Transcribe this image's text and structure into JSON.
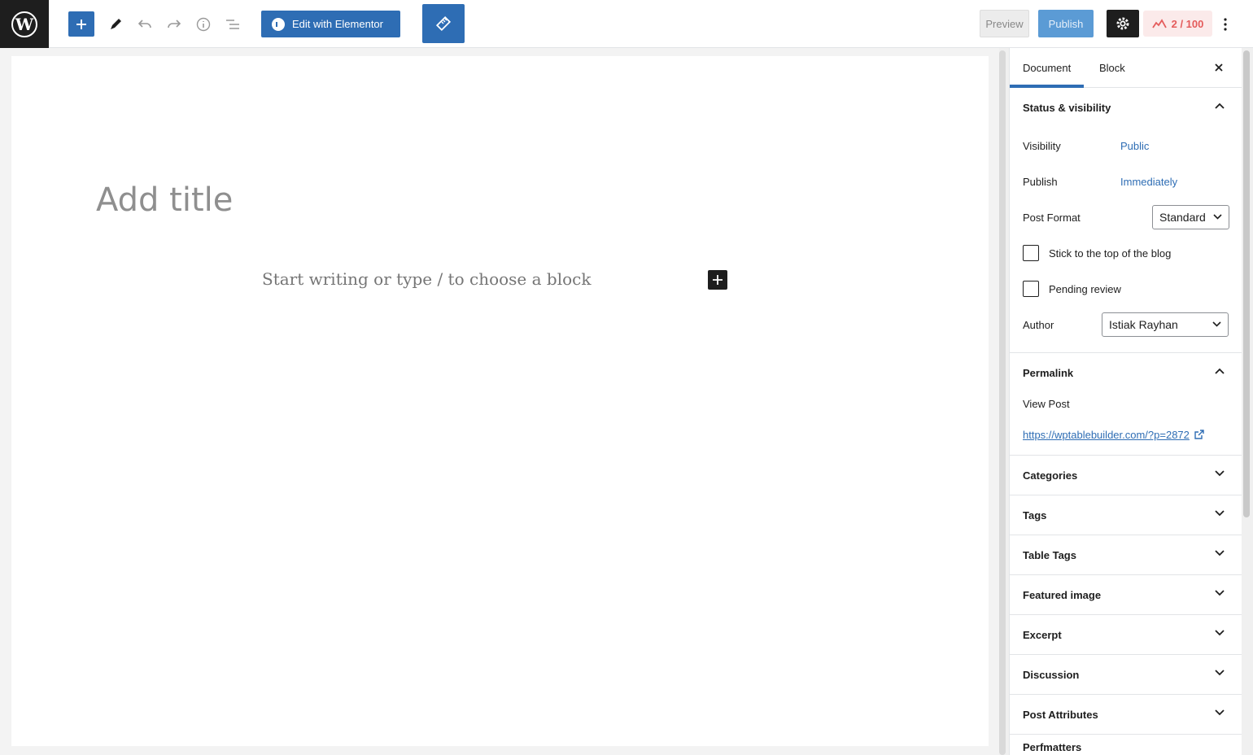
{
  "toolbar": {
    "elementor_label": "Edit with Elementor",
    "preview_label": "Preview",
    "publish_label": "Publish",
    "score_label": "2 / 100"
  },
  "editor": {
    "title_placeholder": "Add title",
    "block_placeholder": "Start writing or type / to choose a block"
  },
  "sidebar": {
    "tabs": {
      "document": "Document",
      "block": "Block"
    },
    "status_visibility": {
      "heading": "Status & visibility",
      "visibility_label": "Visibility",
      "visibility_value": "Public",
      "publish_label": "Publish",
      "publish_value": "Immediately",
      "post_format_label": "Post Format",
      "post_format_value": "Standard",
      "sticky_label": "Stick to the top of the blog",
      "pending_label": "Pending review",
      "author_label": "Author",
      "author_value": "Istiak Rayhan"
    },
    "permalink": {
      "heading": "Permalink",
      "view_post": "View Post",
      "url": "https://wptablebuilder.com/?p=2872"
    },
    "panels": [
      "Categories",
      "Tags",
      "Table Tags",
      "Featured image",
      "Excerpt",
      "Discussion",
      "Post Attributes",
      "Perfmatters"
    ]
  },
  "colors": {
    "accent": "#2e6db4",
    "dark": "#1e1e1e",
    "score_red": "#e45b5b"
  }
}
